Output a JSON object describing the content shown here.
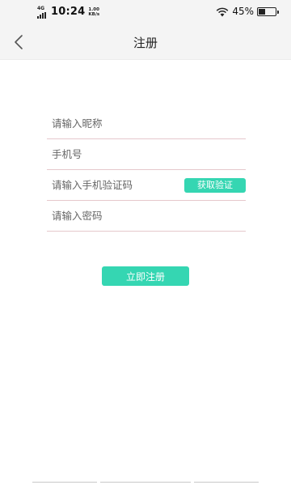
{
  "status_bar": {
    "network": "4G",
    "time": "10:24",
    "speed_value": "1.00",
    "speed_unit": "KB/s",
    "battery": "45%",
    "battery_level": 0.45,
    "icons": [
      "signal-bars-icon",
      "wifi-icon",
      "battery-icon"
    ]
  },
  "header": {
    "title": "注册",
    "back_icon": "chevron-left-icon"
  },
  "form": {
    "nickname_placeholder": "请输入昵称",
    "phone_placeholder": "手机号",
    "code_placeholder": "请输入手机验证码",
    "get_code_label": "获取验证",
    "password_placeholder": "请输入密码"
  },
  "submit_label": "立即注册",
  "colors": {
    "accent": "#35d6b2",
    "field_underline": "#e6c8cc",
    "header_bg": "#f4f4f4"
  }
}
